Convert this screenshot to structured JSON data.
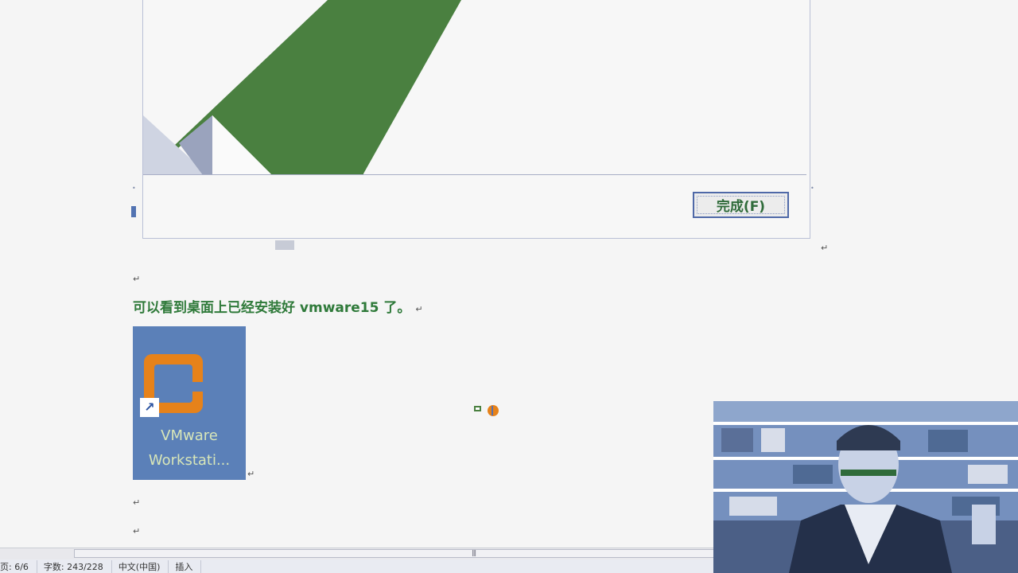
{
  "installer": {
    "finish_button_label": "完成(F)"
  },
  "document": {
    "paragraph_text": "可以看到桌面上已经安装好 vmware15 了。",
    "paragraph_mark": "↵"
  },
  "desktop_icon": {
    "label_line1": "VMware",
    "label_line2": "Workstati...",
    "icon": "vmware-logo-icon",
    "shortcut_icon": "shortcut-arrow-icon",
    "shortcut_glyph": "↗"
  },
  "status_bar": {
    "page": "页: 6/6",
    "word_count": "字数: 243/228",
    "language": "中文(中国)",
    "mode": "插入"
  },
  "colors": {
    "accent_green": "#4a8040",
    "logo_orange": "#e6821a",
    "desktop_blue": "#5b80b8"
  }
}
